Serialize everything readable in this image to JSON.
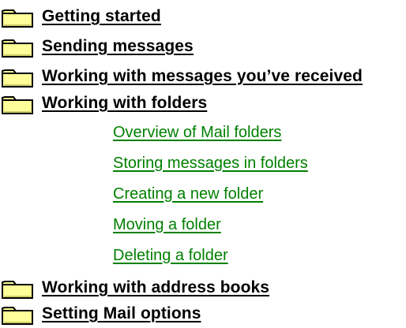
{
  "contents": {
    "topics_before": [
      {
        "label": "Getting started",
        "icon": "closed-folder-icon"
      },
      {
        "label": "Sending messages",
        "icon": "closed-folder-icon"
      },
      {
        "label": "Working with messages you’ve received",
        "icon": "closed-folder-icon"
      },
      {
        "label": "Working with folders",
        "icon": "open-folder-icon"
      }
    ],
    "subtopics": [
      {
        "label": "Overview of Mail folders"
      },
      {
        "label": "Storing messages in folders"
      },
      {
        "label": "Creating a new folder"
      },
      {
        "label": "Moving a folder"
      },
      {
        "label": "Deleting a folder"
      }
    ],
    "topics_after": [
      {
        "label": "Working with address books",
        "icon": "closed-folder-icon"
      },
      {
        "label": "Setting Mail options",
        "icon": "closed-folder-icon"
      }
    ]
  },
  "colors": {
    "topic_link": "#000000",
    "subtopic_link": "#008000",
    "folder_fill": "#FFFF99",
    "folder_outline": "#000000",
    "background": "#FFFFFF"
  }
}
